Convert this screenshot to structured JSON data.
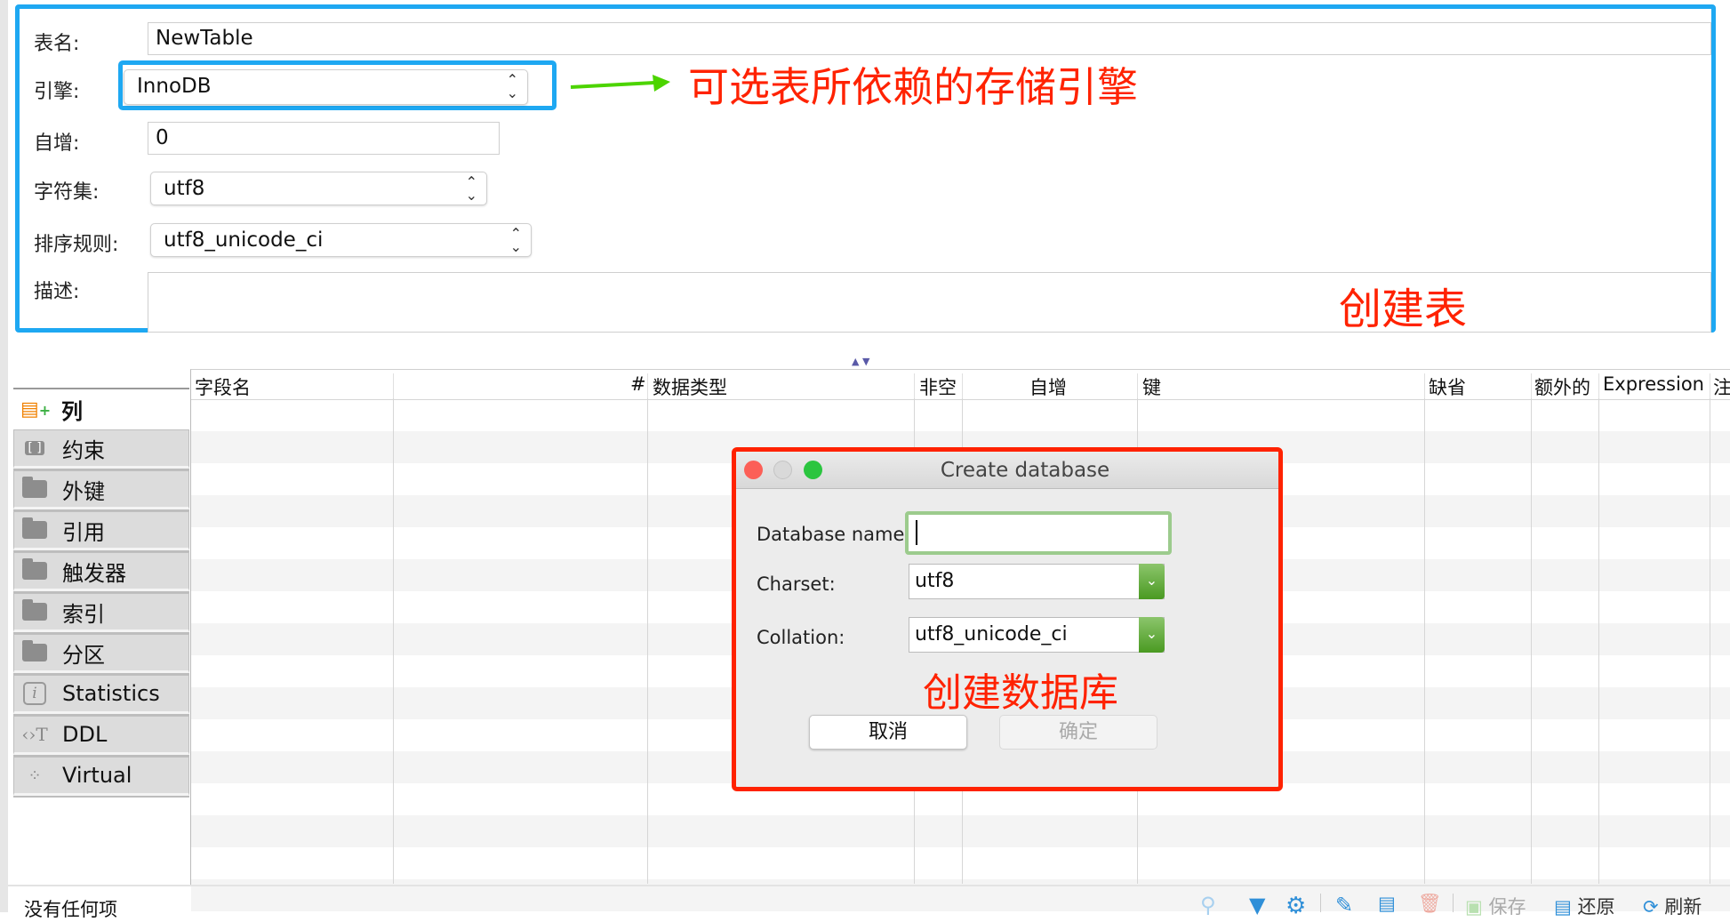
{
  "form": {
    "table_name_label": "表名:",
    "table_name_value": "NewTable",
    "engine_label": "引擎:",
    "engine_value": "InnoDB",
    "auto_increment_label": "自增:",
    "auto_increment_value": "0",
    "charset_label": "字符集:",
    "charset_value": "utf8",
    "collation_label": "排序规则:",
    "collation_value": "utf8_unicode_ci",
    "description_label": "描述:",
    "description_value": ""
  },
  "annotations": {
    "engine_note": "可选表所依赖的存储引擎",
    "create_table": "创建表",
    "create_database": "创建数据库",
    "highlight_blue": "#1ea8f2",
    "highlight_red": "#ff2200",
    "arrow_green": "#4cd400"
  },
  "table": {
    "columns": [
      "字段名",
      "#",
      "数据类型",
      "非空",
      "自增",
      "键",
      "缺省",
      "额外的",
      "Expression",
      "注"
    ]
  },
  "sidebar": {
    "items": [
      {
        "label": "列",
        "icon": "add-column-icon"
      },
      {
        "label": "约束",
        "icon": "constraint-icon"
      },
      {
        "label": "外键",
        "icon": "folder-icon"
      },
      {
        "label": "引用",
        "icon": "folder-icon"
      },
      {
        "label": "触发器",
        "icon": "folder-icon"
      },
      {
        "label": "索引",
        "icon": "folder-icon"
      },
      {
        "label": "分区",
        "icon": "folder-icon"
      },
      {
        "label": "Statistics",
        "icon": "info-icon"
      },
      {
        "label": "DDL",
        "icon": "code-text-icon"
      },
      {
        "label": "Virtual",
        "icon": "virtual-icon"
      }
    ]
  },
  "status": {
    "empty_text": "没有任何项"
  },
  "toolbar": {
    "save": "保存",
    "revert": "还原",
    "refresh": "刷新"
  },
  "dialog": {
    "title": "Create database",
    "name_label": "Database name:",
    "name_value": "",
    "charset_label": "Charset:",
    "charset_value": "utf8",
    "collation_label": "Collation:",
    "collation_value": "utf8_unicode_ci",
    "cancel": "取消",
    "ok": "确定"
  }
}
